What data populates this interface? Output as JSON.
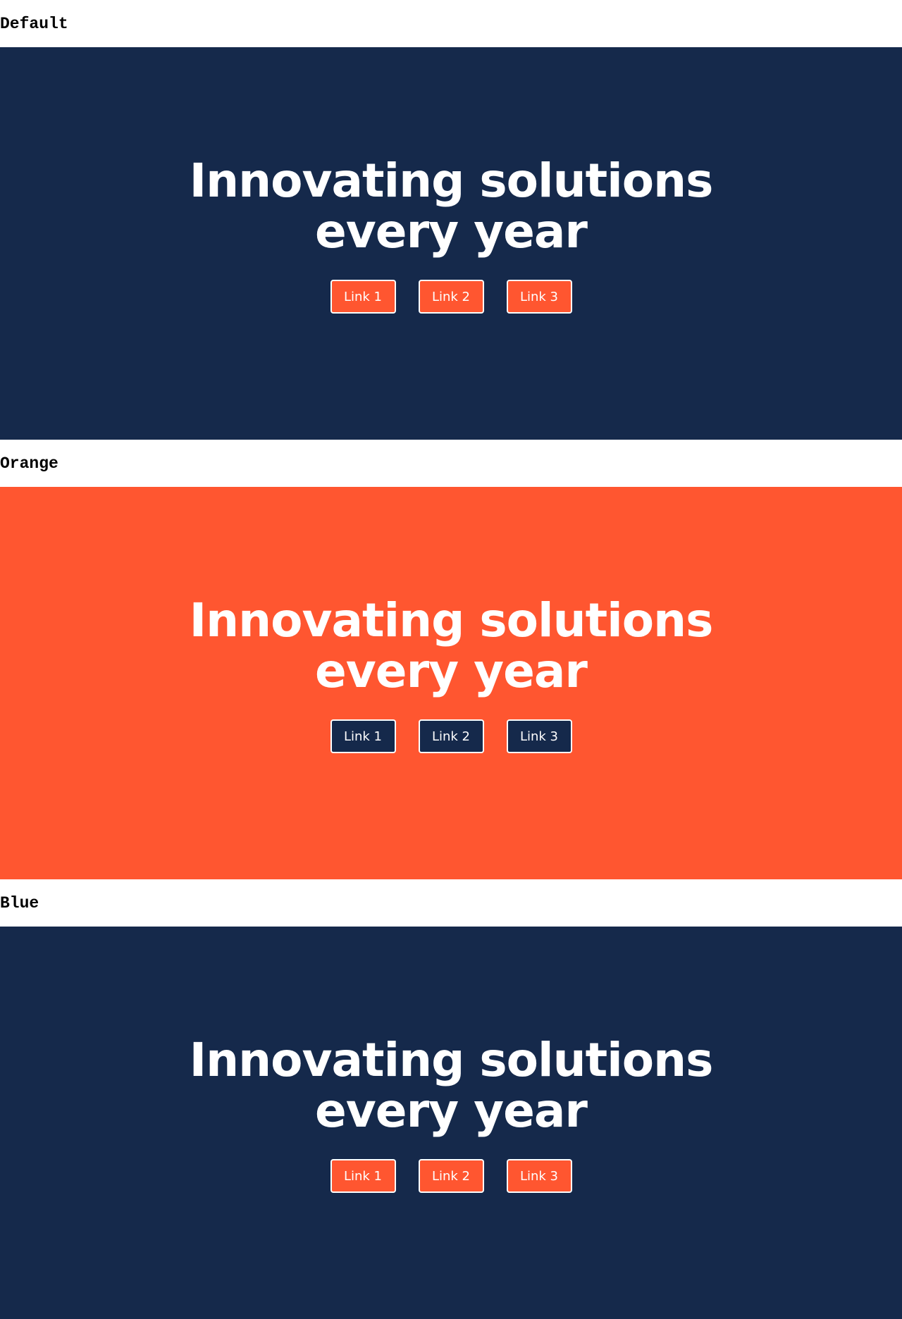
{
  "colors": {
    "navy": "#15294b",
    "orange": "#ff5630",
    "white": "#ffffff"
  },
  "variants": [
    {
      "label": "Default",
      "title_line1": "Innovating solutions",
      "title_line2": "every year",
      "links": [
        "Link 1",
        "Link 2",
        "Link 3"
      ],
      "background": "#15294b",
      "button_background": "#ff5630"
    },
    {
      "label": "Orange",
      "title_line1": "Innovating solutions",
      "title_line2": "every year",
      "links": [
        "Link 1",
        "Link 2",
        "Link 3"
      ],
      "background": "#ff5630",
      "button_background": "#15294b"
    },
    {
      "label": "Blue",
      "title_line1": "Innovating solutions",
      "title_line2": "every year",
      "links": [
        "Link 1",
        "Link 2",
        "Link 3"
      ],
      "background": "#15294b",
      "button_background": "#ff5630"
    }
  ]
}
